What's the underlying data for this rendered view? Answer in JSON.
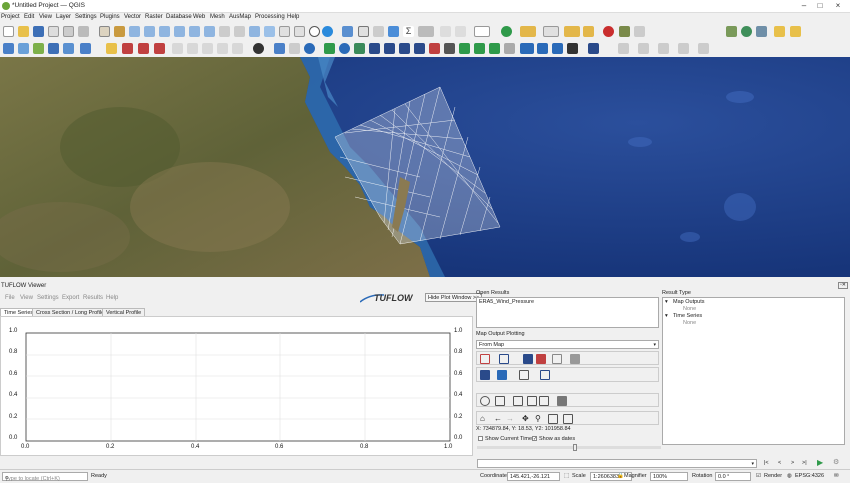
{
  "window": {
    "title": "*Untitled Project — QGIS"
  },
  "menu": [
    "Project",
    "Edit",
    "View",
    "Layer",
    "Settings",
    "Plugins",
    "Vector",
    "Raster",
    "Database",
    "Web",
    "Mesh",
    "AusMap",
    "Processing",
    "Help"
  ],
  "toolbar": {
    "scale_value": "12",
    "unit": "px"
  },
  "tuflow": {
    "title": "TUFLOW Viewer",
    "menu": [
      "File",
      "View",
      "Settings",
      "Export",
      "Results",
      "Help"
    ],
    "logo": "TUFLOW",
    "hide_plot_button": "Hide Plot Window >>",
    "tabs": [
      "Time Series",
      "Cross Section / Long Profile",
      "Vertical Profile"
    ],
    "plot": {
      "x_ticks": [
        "0.0",
        "0.2",
        "0.4",
        "0.6",
        "0.8",
        "1.0"
      ],
      "y_ticks": [
        "0.0",
        "0.2",
        "0.4",
        "0.6",
        "0.8",
        "1.0"
      ],
      "y2_ticks": [
        "0.0",
        "0.2",
        "0.4",
        "0.6",
        "0.8",
        "1.0"
      ]
    },
    "open_results_label": "Open Results",
    "open_results": [
      "ERA5_Wind_Pressure"
    ],
    "map_output_plotting_label": "Map Output Plotting",
    "map_output_select": "From Map",
    "coords": "X: 734879.84, Y: 18.53, Y2: 101958.84",
    "show_current_time": "Show Current Time",
    "show_as_dates": "Show as dates",
    "result_type_label": "Result Type",
    "result_tree": [
      {
        "label": "Map Outputs",
        "child": "None"
      },
      {
        "label": "Time Series",
        "child": "None"
      }
    ],
    "time_arrows": [
      "|<",
      "<",
      ">",
      ">|"
    ]
  },
  "status": {
    "locate_placeholder": "Type to locate (Ctrl+K)",
    "ready": "Ready",
    "coordinate_label": "Coordinate",
    "coordinate": "145.421,-26.121",
    "scale_label": "Scale",
    "scale": "1:2606383",
    "magnifier_label": "Magnifier",
    "magnifier": "100%",
    "rotation_label": "Rotation",
    "rotation": "0.0 °",
    "render_label": "Render",
    "crs": "EPSG:4326"
  },
  "colors": {
    "accent": "#2a6ab8",
    "qgis_green": "#6ba539",
    "sea": "#1f3f8a",
    "land": "#6f6a3f"
  }
}
